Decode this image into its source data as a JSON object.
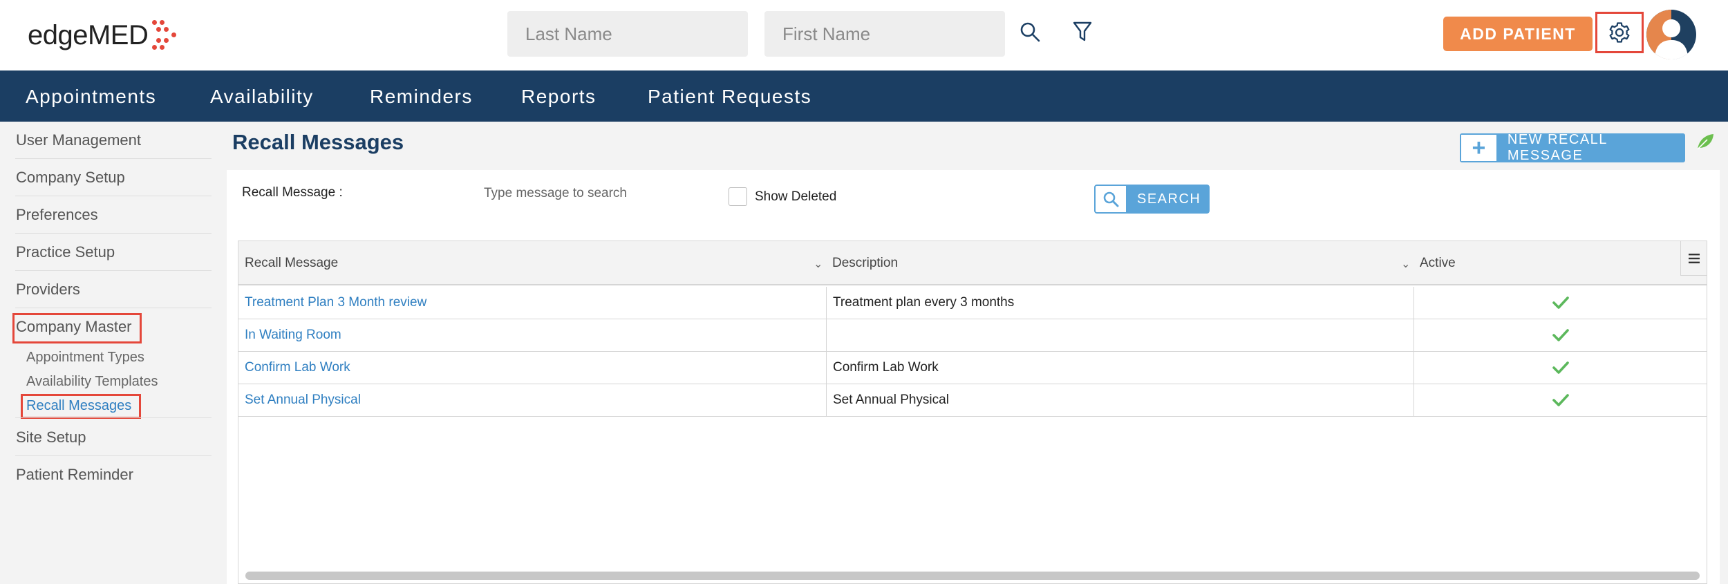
{
  "header": {
    "logo_text": "edgeMED",
    "last_name_placeholder": "Last Name",
    "first_name_placeholder": "First Name",
    "add_patient_label": "ADD PATIENT",
    "icons": [
      "search-icon",
      "filter-icon",
      "gear-icon",
      "user-avatar"
    ]
  },
  "navbar": {
    "items": [
      "Appointments",
      "Availability",
      "Reminders",
      "Reports",
      "Patient Requests"
    ]
  },
  "sidebar": {
    "items": [
      "User Management",
      "Company Setup",
      "Preferences",
      "Practice Setup",
      "Providers",
      "Company Master",
      "Site Setup",
      "Patient Reminder"
    ],
    "subitems": [
      "Appointment Types",
      "Availability Templates",
      "Recall Messages"
    ],
    "active_subitem": "Recall Messages"
  },
  "main": {
    "title": "Recall Messages",
    "new_button_label": "NEW RECALL MESSAGE",
    "filter_label": "Recall Message :",
    "filter_placeholder": "Type message to search",
    "show_deleted_label": "Show Deleted",
    "search_label": "SEARCH"
  },
  "grid": {
    "columns": [
      "Recall Message",
      "Description",
      "Active"
    ],
    "rows": [
      {
        "message": "Treatment Plan 3 Month review",
        "description": "Treatment plan every 3 months",
        "active": true
      },
      {
        "message": "In Waiting Room",
        "description": "",
        "active": true
      },
      {
        "message": "Confirm Lab Work",
        "description": "Confirm Lab Work",
        "active": true
      },
      {
        "message": "Set Annual Physical",
        "description": "Set Annual Physical",
        "active": true
      }
    ]
  },
  "colors": {
    "navy": "#1b3e63",
    "orange": "#f08a4b",
    "accent_blue": "#5aa4d9",
    "link_blue": "#2f7fc1",
    "highlight_red": "#e4473a",
    "check_green": "#5cb85c"
  }
}
